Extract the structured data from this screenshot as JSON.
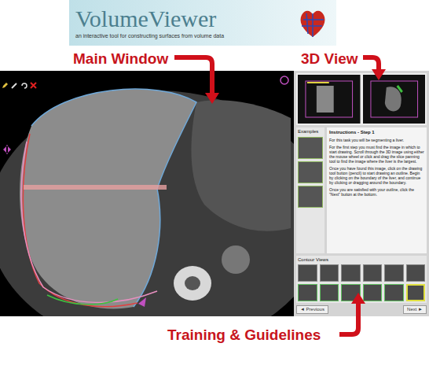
{
  "logo": {
    "title": "VolumeViewer",
    "subtitle": "an interactive tool for constructing surfaces from volume data"
  },
  "callouts": {
    "main": "Main Window",
    "view3d": "3D View",
    "training": "Training & Guidelines"
  },
  "panel": {
    "examples": "Examples",
    "instructions_title": "Instructions - Step 1",
    "instructions": [
      "For this task you will be segmenting a liver.",
      "For the first step you must find the image in which to start drawing. Scroll through the 3D image using either the mouse wheel or click and drag the slice panning tool to find the image where the liver is the largest.",
      "Once you have found this image, click on the drawing tool button (pencil) to start drawing an outline. Begin by clicking on the boundary of the liver, and continue by clicking or dragging around the boundary.",
      "Once you are satisfied with your outline, click the \"Next\" button at the bottom."
    ],
    "contour_title": "Contour Views",
    "contours": [
      {
        "done": false,
        "selected": false
      },
      {
        "done": false,
        "selected": false
      },
      {
        "done": false,
        "selected": false
      },
      {
        "done": false,
        "selected": false
      },
      {
        "done": false,
        "selected": false
      },
      {
        "done": false,
        "selected": false
      },
      {
        "done": true,
        "selected": false
      },
      {
        "done": true,
        "selected": false
      },
      {
        "done": true,
        "selected": false
      },
      {
        "done": true,
        "selected": false
      },
      {
        "done": true,
        "selected": false
      },
      {
        "done": false,
        "selected": true
      }
    ],
    "prev": "◄ Previous",
    "next": "Next ►"
  }
}
